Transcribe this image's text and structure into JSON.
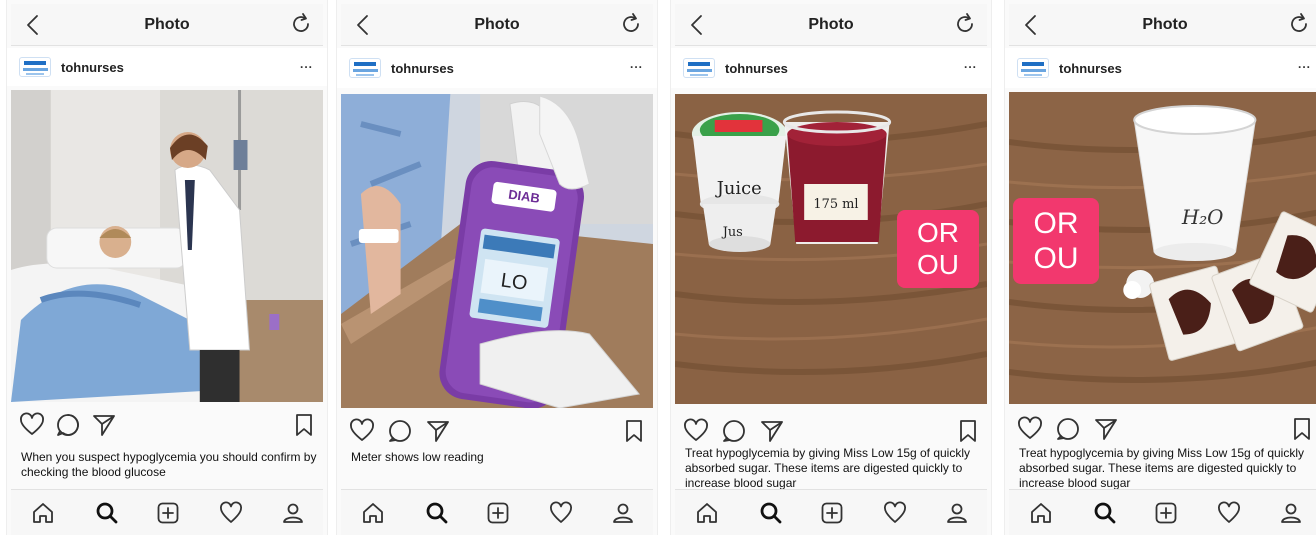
{
  "screens": [
    {
      "title": "Photo",
      "username": "tohnurses",
      "more": "...",
      "caption": "When you suspect hypoglycemia you should confirm by checking the blood glucose"
    },
    {
      "title": "Photo",
      "username": "tohnurses",
      "more": "...",
      "caption": "Meter shows low reading",
      "meter": {
        "brand": "DIAB",
        "reading": "LO"
      }
    },
    {
      "title": "Photo",
      "username": "tohnurses",
      "more": "...",
      "caption": "Treat hypoglycemia by giving Miss Low 15g of quickly absorbed sugar. These items are digested quickly to increase blood sugar",
      "cup_labels": {
        "juice": "Juice",
        "jus": "Jus",
        "volume": "175 ml"
      },
      "sticker": {
        "line1": "OR",
        "line2": "OU"
      }
    },
    {
      "title": "Photo",
      "username": "tohnurses",
      "more": "...",
      "caption": "Treat hypoglycemia by giving Miss Low 15g of quickly absorbed sugar. These items are digested quickly to increase blood sugar",
      "cup_label": "H₂O",
      "sticker": {
        "line1": "OR",
        "line2": "OU"
      }
    }
  ],
  "icons": {
    "back": "chevron-left-icon",
    "refresh": "refresh-icon",
    "like": "heart-icon",
    "comment": "comment-icon",
    "share": "send-icon",
    "save": "bookmark-icon",
    "home": "home-icon",
    "search": "search-icon",
    "add": "add-icon",
    "activity": "heart-icon",
    "profile": "profile-icon"
  },
  "colors": {
    "sticker": "#f2386e",
    "meter": "#7a3ca6"
  }
}
